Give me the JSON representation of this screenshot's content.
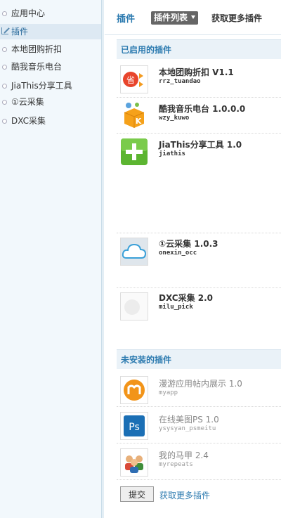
{
  "sidebar": {
    "items": [
      {
        "label": "应用中心",
        "icon": "circle-bullet-icon"
      },
      {
        "label": "插件",
        "icon": "edit-icon",
        "active": true
      },
      {
        "label": "本地团购折扣",
        "icon": "circle-bullet-icon"
      },
      {
        "label": "酷我音乐电台",
        "icon": "circle-bullet-icon"
      },
      {
        "label": "JiaThis分享工具",
        "icon": "circle-bullet-icon"
      },
      {
        "label": "①云采集",
        "icon": "circle-bullet-icon"
      },
      {
        "label": "DXC采集",
        "icon": "circle-bullet-icon"
      }
    ]
  },
  "header": {
    "title": "插件",
    "list_button": "插件列表",
    "more_link": "获取更多插件"
  },
  "enabled": {
    "heading": "已启用的插件",
    "plugins": [
      {
        "name": "本地团购折扣  V1.1",
        "id": "rrz_tuandao",
        "icon": "discount-sale-icon"
      },
      {
        "name": "酷我音乐电台  1.0.0.0",
        "id": "wzy_kuwo",
        "icon": "kuwo-music-icon"
      },
      {
        "name": "JiaThis分享工具  1.0",
        "id": "jiathis",
        "icon": "green-plus-icon"
      },
      {
        "name": "①云采集  1.0.3",
        "id": "onexin_occ",
        "icon": "cloud-icon"
      },
      {
        "name": "DXC采集  2.0",
        "id": "milu_pick",
        "icon": "blank-plugin-icon"
      }
    ]
  },
  "uninstalled": {
    "heading": "未安装的插件",
    "plugins": [
      {
        "name": "漫游应用帖内展示  1.0",
        "id": "myapp",
        "icon": "manyou-app-icon"
      },
      {
        "name": "在线美图PS  1.0",
        "id": "ysysyan_psmeitu",
        "icon": "photoshop-icon"
      },
      {
        "name": "我的马甲  2.4",
        "id": "myrepeats",
        "icon": "users-icon"
      }
    ]
  },
  "footer": {
    "submit": "提交",
    "more_link": "获取更多插件"
  },
  "colors": {
    "accent": "#2d7bb0",
    "sidebar_bg": "#f2f8fc",
    "section_bg": "#eaf2f8"
  }
}
